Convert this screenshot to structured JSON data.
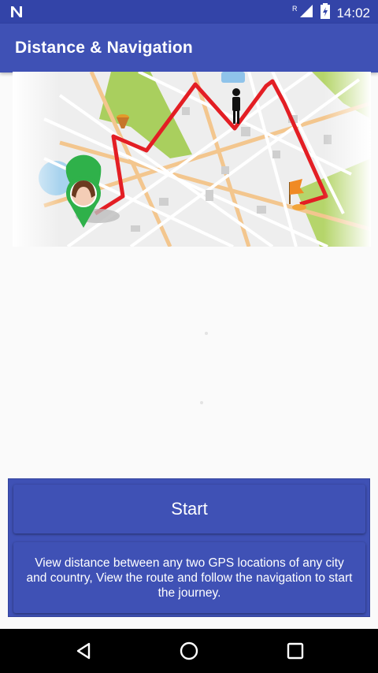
{
  "status_bar": {
    "time": "14:02",
    "roaming_label": "R",
    "icons": [
      "notification-n-icon",
      "signal-icon",
      "battery-icon"
    ]
  },
  "app_bar": {
    "title": "Distance & Navigation"
  },
  "hero": {
    "image": "route-map-illustration"
  },
  "actions": {
    "start_label": "Start",
    "description": "View distance between any two GPS locations of any city and country, View the route and follow the navigation to start the journey."
  },
  "nav_bar": {
    "icons": [
      "back-icon",
      "home-icon",
      "recents-icon"
    ]
  },
  "colors": {
    "primary": "#3f51b5",
    "primary_dark": "#3344a8",
    "route": "#e31e24",
    "pin": "#2fb14a"
  }
}
